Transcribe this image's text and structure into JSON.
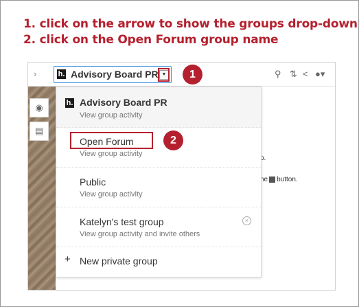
{
  "instructions": [
    "1. click on the arrow to show the groups drop-down",
    "2. click on the Open Forum group name"
  ],
  "callouts": {
    "step1": "1",
    "step2": "2"
  },
  "topbar": {
    "group_name": "Advisory Board PR",
    "logo_letter": "h.",
    "icons": [
      "chevron-left-icon",
      "search-icon",
      "sort-icon",
      "share-icon",
      "user-icon"
    ]
  },
  "dropdown": {
    "items": [
      {
        "name": "Advisory Board PR",
        "sub": "View group activity"
      },
      {
        "name": "Open Forum",
        "sub": "View group activity"
      },
      {
        "name": "Public",
        "sub": "View group activity"
      },
      {
        "name": "Katelyn's test group",
        "sub": "View group activity and invite others"
      }
    ],
    "new_group": "New private group"
  },
  "background": {
    "line1": "p.",
    "line2a": "he",
    "line2b": "button."
  },
  "colors": {
    "accent": "#b5202e",
    "focus": "#3c8fde"
  }
}
